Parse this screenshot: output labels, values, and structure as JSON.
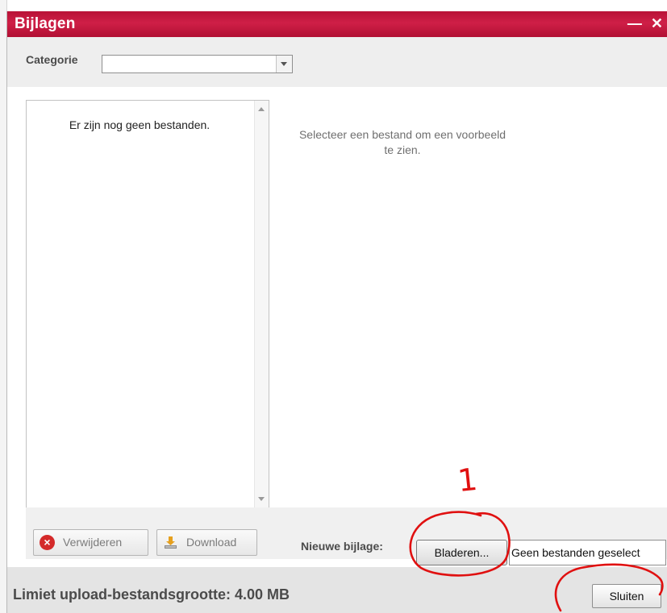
{
  "dialog": {
    "title": "Bijlagen",
    "controls": {
      "minimize": "—",
      "close": "✕"
    }
  },
  "category": {
    "label": "Categorie",
    "value": ""
  },
  "file_list": {
    "empty_message": "Er zijn nog geen bestanden."
  },
  "preview": {
    "message": "Selecteer een bestand om een voorbeeld te zien."
  },
  "actions": {
    "delete_label": "Verwijderen",
    "download_label": "Download"
  },
  "upload": {
    "new_label": "Nieuwe bijlage:",
    "browse_label": "Bladeren...",
    "file_status": "Geen bestanden geselect"
  },
  "footer": {
    "limit_text": "Limiet upload-bestandsgrootte: 4.00 MB",
    "close_label": "Sluiten"
  },
  "annotation": {
    "number": "1",
    "color": "#e01010"
  },
  "colors": {
    "titlebar": "#c41840",
    "toolbar": "#f0f0f0",
    "footer": "#e4e4e4"
  }
}
